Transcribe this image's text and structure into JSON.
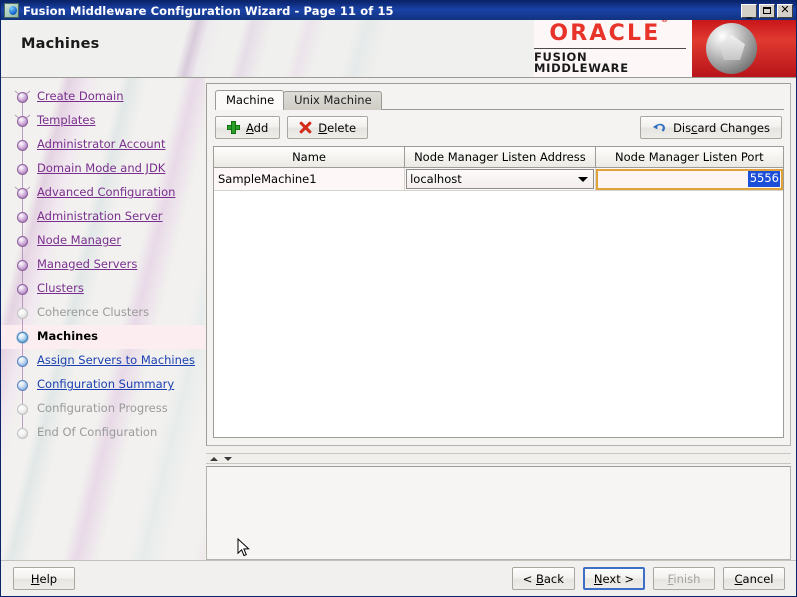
{
  "window": {
    "title": "Fusion Middleware Configuration Wizard - Page 11 of 15",
    "icon": "globe-icon",
    "minimize_label": "_",
    "maximize_label": "",
    "close_label": "✕"
  },
  "header": {
    "page_title": "Machines",
    "brand_name": "ORACLE",
    "brand_trademark": "®",
    "brand_product": "FUSION MIDDLEWARE"
  },
  "sidebar": {
    "items": [
      {
        "label": "Create Domain",
        "state": "done",
        "branch": true
      },
      {
        "label": "Templates",
        "state": "done",
        "branch": true
      },
      {
        "label": "Administrator Account",
        "state": "done",
        "branch": false
      },
      {
        "label": "Domain Mode and JDK",
        "state": "done",
        "branch": false
      },
      {
        "label": "Advanced Configuration",
        "state": "done",
        "branch": true
      },
      {
        "label": "Administration Server",
        "state": "done",
        "branch": false
      },
      {
        "label": "Node Manager",
        "state": "done",
        "branch": false
      },
      {
        "label": "Managed Servers",
        "state": "done",
        "branch": false
      },
      {
        "label": "Clusters",
        "state": "done",
        "branch": false
      },
      {
        "label": "Coherence Clusters",
        "state": "off",
        "branch": false
      },
      {
        "label": "Machines",
        "state": "current",
        "branch": false
      },
      {
        "label": "Assign Servers to Machines",
        "state": "todo",
        "branch": false
      },
      {
        "label": "Configuration Summary",
        "state": "todo",
        "branch": false
      },
      {
        "label": "Configuration Progress",
        "state": "off",
        "branch": false
      },
      {
        "label": "End Of Configuration",
        "state": "off",
        "branch": false
      }
    ]
  },
  "main": {
    "tabs": [
      {
        "label": "Machine",
        "active": true
      },
      {
        "label": "Unix Machine",
        "active": false
      }
    ],
    "toolbar": {
      "add_label": "Add",
      "delete_label": "Delete",
      "discard_label": "Discard Changes"
    },
    "table": {
      "columns": [
        "Name",
        "Node Manager Listen Address",
        "Node Manager Listen Port"
      ],
      "rows": [
        {
          "name": "SampleMachine1",
          "listen_address": "localhost",
          "listen_port": "5556"
        }
      ]
    }
  },
  "footer": {
    "help_label": "Help",
    "back_label": "< Back",
    "next_label": "Next >",
    "finish_label": "Finish",
    "cancel_label": "Cancel"
  }
}
